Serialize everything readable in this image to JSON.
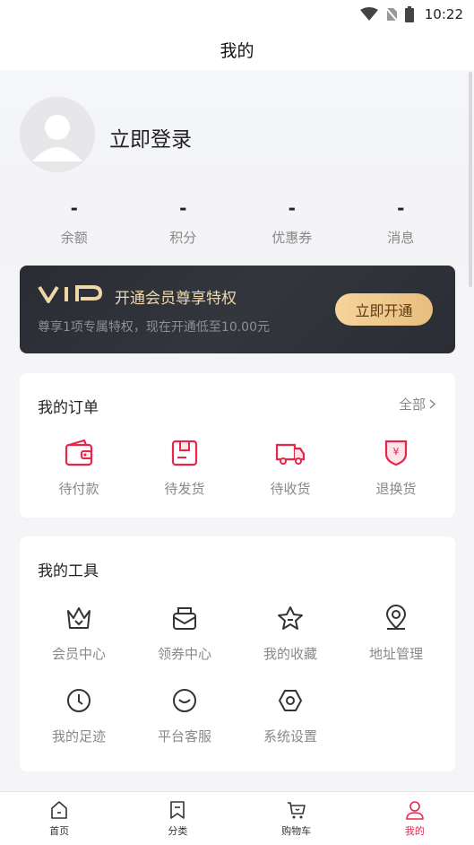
{
  "status_bar": {
    "time": "10:22"
  },
  "header": {
    "title": "我的"
  },
  "profile": {
    "login_label": "立即登录"
  },
  "stats": [
    {
      "value": "-",
      "label": "余额"
    },
    {
      "value": "-",
      "label": "积分"
    },
    {
      "value": "-",
      "label": "优惠券"
    },
    {
      "value": "-",
      "label": "消息"
    }
  ],
  "vip": {
    "headline": "开通会员尊享特权",
    "subtitle": "尊享1项专属特权，现在开通低至10.00元",
    "button": "立即开通",
    "accent": "#f1d7a8"
  },
  "orders": {
    "title": "我的订单",
    "more": "全部",
    "items": [
      {
        "label": "待付款",
        "icon": "wallet-icon"
      },
      {
        "label": "待发货",
        "icon": "package-icon"
      },
      {
        "label": "待收货",
        "icon": "truck-icon"
      },
      {
        "label": "退换货",
        "icon": "refund-icon"
      }
    ],
    "accent": "#e8264a"
  },
  "tools": {
    "title": "我的工具",
    "items": [
      {
        "label": "会员中心",
        "icon": "crown-icon"
      },
      {
        "label": "领券中心",
        "icon": "coupon-icon"
      },
      {
        "label": "我的收藏",
        "icon": "star-icon"
      },
      {
        "label": "地址管理",
        "icon": "location-icon"
      },
      {
        "label": "我的足迹",
        "icon": "clock-icon"
      },
      {
        "label": "平台客服",
        "icon": "chat-icon"
      },
      {
        "label": "系统设置",
        "icon": "settings-icon"
      }
    ]
  },
  "tabbar": {
    "tabs": [
      {
        "label": "首页",
        "icon": "home-icon"
      },
      {
        "label": "分类",
        "icon": "category-icon"
      },
      {
        "label": "购物车",
        "icon": "cart-icon"
      },
      {
        "label": "我的",
        "icon": "user-icon",
        "active": true
      }
    ],
    "active_color": "#e8264a"
  }
}
